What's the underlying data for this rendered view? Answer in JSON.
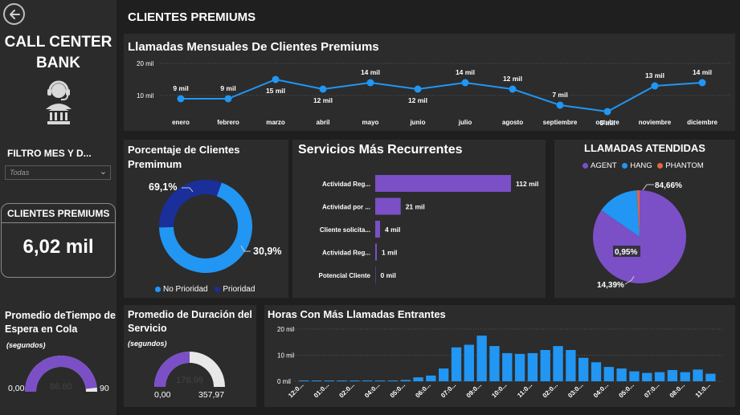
{
  "sidebar": {
    "app_title": "CALL CENTER\nBANK",
    "filter_label": "FILTRO MES Y D...",
    "filter_value": "Todas",
    "kpi_title": "CLIENTES PREMIUMS",
    "kpi_value": "6,02 mil",
    "wait_title": "Promedio deTiempo de Espera en Cola",
    "wait_sub": "(segundos)",
    "wait_gauge": {
      "min_label": "0,00",
      "max_label": "90",
      "value_label": "86.80",
      "fraction": 0.964
    }
  },
  "header": {
    "title": "CLIENTES PREMIUMS"
  },
  "colors": {
    "accent": "#2196f3",
    "purple": "#7b4fc6",
    "navy": "#1a2f9a",
    "orange": "#e5673a"
  },
  "chart_data": [
    {
      "type": "line",
      "title": "Llamadas Mensuales De Clientes Premiums",
      "categories": [
        "enero",
        "febrero",
        "marzo",
        "abril",
        "mayo",
        "junio",
        "julio",
        "agosto",
        "septiembre",
        "octubre",
        "noviembre",
        "diciembre"
      ],
      "values": [
        9,
        9,
        15,
        12,
        14,
        12,
        14,
        12,
        7,
        5,
        13,
        14
      ],
      "data_labels": [
        "9 mil",
        "9 mil",
        "15 mil",
        "12 mil",
        "14 mil",
        "12 mil",
        "14 mil",
        "12 mil",
        "7 mil",
        "5 mil",
        "13 mil",
        "14 mil"
      ],
      "y_ticks": [
        "20 mil",
        "10 mil"
      ],
      "grid": true
    },
    {
      "type": "pie",
      "title": "Porcentaje de Clientes Premimum",
      "slices": [
        {
          "name": "No Prioridad",
          "value": 69.1,
          "label": "69,1%",
          "color": "#2196f3"
        },
        {
          "name": "Prioridad",
          "value": 30.9,
          "label": "30,9%",
          "color": "#1a2f9a"
        }
      ]
    },
    {
      "type": "bar",
      "title": "Servicios Más Recurrentes",
      "categories": [
        "Actividad Reg...",
        "Actividad por ...",
        "Cliente solicita...",
        "Actividad Reg...",
        "Potencial Cliente"
      ],
      "values": [
        112,
        21,
        4,
        1,
        0
      ],
      "data_labels": [
        "112 mil",
        "21 mil",
        "4 mil",
        "1 mil",
        "0 mil"
      ],
      "orientation": "horizontal"
    },
    {
      "type": "pie",
      "title": "LLAMADAS ATENDIDAS",
      "slices": [
        {
          "name": "AGENT",
          "value": 84.66,
          "label": "84,66%",
          "color": "#7b4fc6"
        },
        {
          "name": "HANG",
          "value": 14.39,
          "label": "14,39%",
          "color": "#2196f3"
        },
        {
          "name": "PHANTOM",
          "value": 0.95,
          "label": "0,95%",
          "color": "#e5673a"
        }
      ],
      "legend": "top"
    },
    {
      "type": "bar",
      "title": "Horas Con Más Llamadas Entrantes",
      "categories": [
        "12:0...",
        "",
        "01:0...",
        "",
        "02:0...",
        "",
        "04:0...",
        "",
        "05:0...",
        "",
        "06:0...",
        "",
        "07:0...",
        "",
        "09:0...",
        "",
        "10:0...",
        "",
        "11:0...",
        "",
        "02:0...",
        "",
        "03:0...",
        "",
        "04:0...",
        "",
        "05:0...",
        "",
        "07:0...",
        "",
        "08:0...",
        "",
        "11:0...",
        ""
      ],
      "values": [
        0.2,
        0.2,
        0.2,
        0.2,
        0.2,
        0.2,
        0.2,
        0.3,
        0.5,
        1.5,
        2.2,
        4.9,
        13,
        14,
        17.5,
        13.5,
        10.8,
        10.5,
        10.8,
        12,
        13.5,
        12,
        9,
        7.3,
        5.5,
        4.9,
        3.8,
        3.2,
        3.5,
        4.3,
        3.5,
        4.5,
        2.9
      ],
      "y_ticks": [
        "20 mil",
        "10 mil",
        "0 mil"
      ],
      "ylim": [
        0,
        20
      ]
    }
  ],
  "service_gauge": {
    "title": "Promedio de Duración del Servicio",
    "sub": "(segundos)",
    "min_label": "0,00",
    "max_label": "357,97",
    "value_label": "178.99",
    "fraction": 0.5
  }
}
